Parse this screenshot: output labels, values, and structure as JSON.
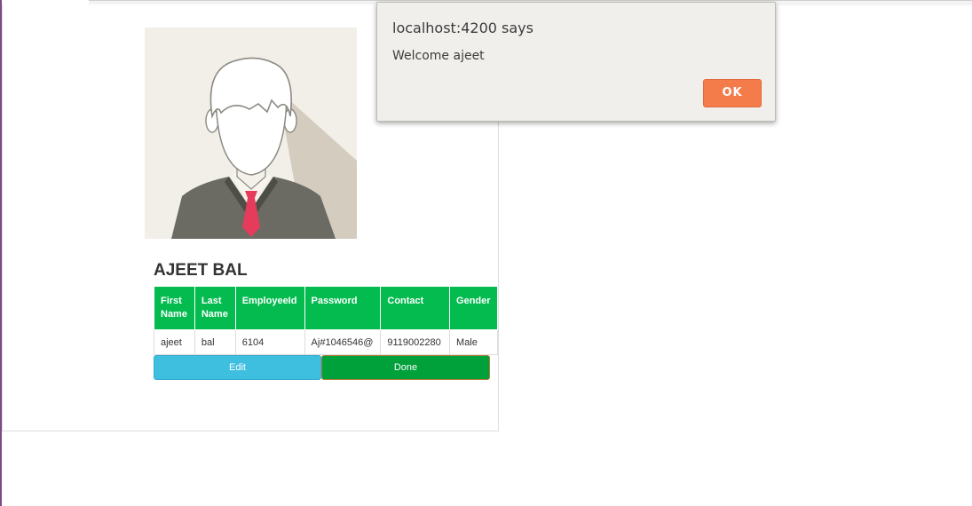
{
  "profile": {
    "name": "AJEET BAL"
  },
  "table": {
    "headers": [
      "First Name",
      "Last Name",
      "EmployeeId",
      "Password",
      "Contact",
      "Gender"
    ],
    "row": [
      "ajeet",
      "bal",
      "6104",
      "Aj#1046546@",
      "9119002280",
      "Male"
    ]
  },
  "buttons": {
    "edit": "Edit",
    "done": "Done"
  },
  "dialog": {
    "title": "localhost:4200 says",
    "message": "Welcome ajeet",
    "ok": "OK"
  },
  "colors": {
    "header_green": "#03bb4f",
    "edit_blue": "#3fbfe0",
    "done_green": "#00a03b",
    "ok_orange": "#f47c4a"
  }
}
